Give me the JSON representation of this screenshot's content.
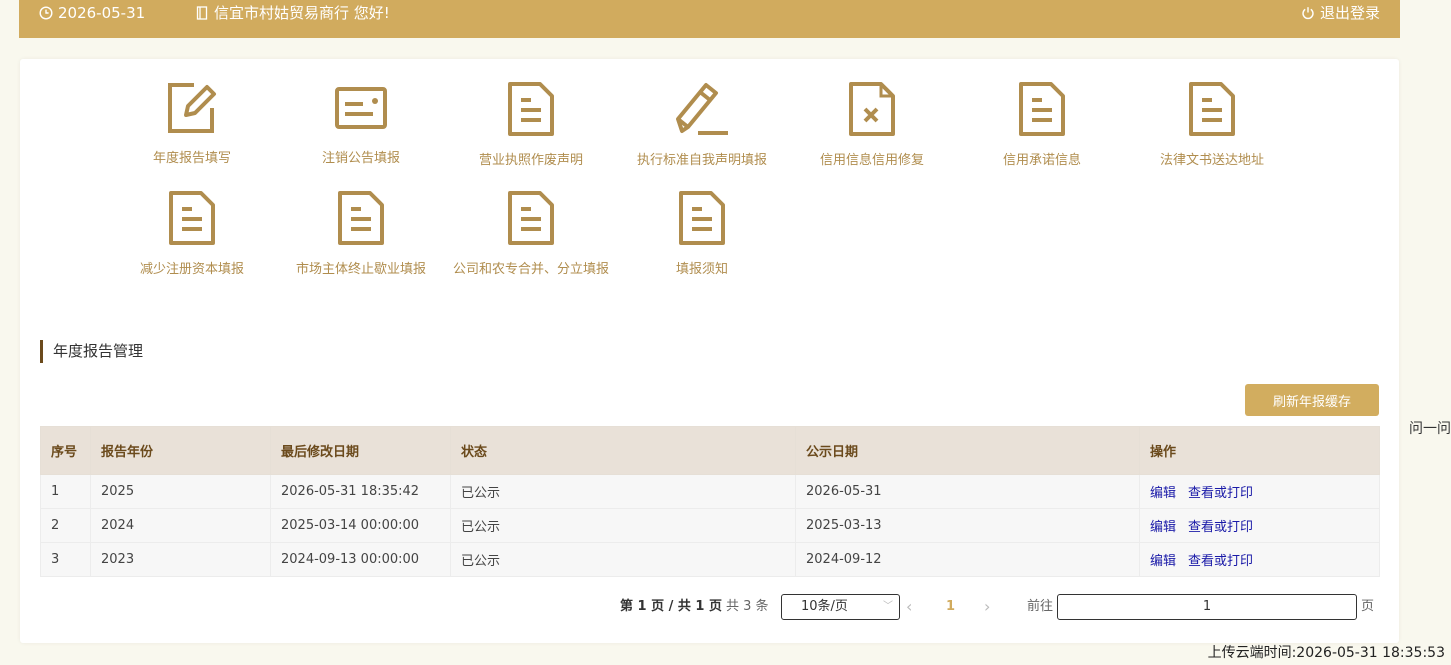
{
  "header": {
    "date": "2026-05-31",
    "greeting": "信宜市村姑贸易商行 您好!",
    "logout_label": "退出登录"
  },
  "side_note": "问一问",
  "footer": {
    "upload_time": "上传云端时间:2026-05-31 18:35:53"
  },
  "menu": [
    {
      "label": "年度报告填写",
      "icon": "edit-icon"
    },
    {
      "label": "注销公告填报",
      "icon": "card-icon"
    },
    {
      "label": "营业执照作废声明",
      "icon": "document-icon"
    },
    {
      "label": "执行标准自我声明填报",
      "icon": "pen-icon"
    },
    {
      "label": "信用信息信用修复",
      "icon": "document-x-icon"
    },
    {
      "label": "信用承诺信息",
      "icon": "document-icon"
    },
    {
      "label": "法律文书送达地址",
      "icon": "document-icon"
    },
    {
      "label": "减少注册资本填报",
      "icon": "document-icon"
    },
    {
      "label": "市场主体终止歇业填报",
      "icon": "document-icon"
    },
    {
      "label": "公司和农专合并、分立填报",
      "icon": "document-icon"
    },
    {
      "label": "填报须知",
      "icon": "document-icon"
    }
  ],
  "section": {
    "title": "年度报告管理",
    "refresh_label": "刷新年报缓存"
  },
  "table": {
    "headers": [
      "序号",
      "报告年份",
      "最后修改日期",
      "状态",
      "公示日期",
      "操作"
    ],
    "rows": [
      {
        "no": "1",
        "year": "2025",
        "modified": "2026-05-31 18:35:42",
        "status": "已公示",
        "publish": "2026-05-31",
        "edit": "编辑",
        "view": "查看或打印"
      },
      {
        "no": "2",
        "year": "2024",
        "modified": "2025-03-14 00:00:00",
        "status": "已公示",
        "publish": "2025-03-13",
        "edit": "编辑",
        "view": "查看或打印"
      },
      {
        "no": "3",
        "year": "2023",
        "modified": "2024-09-13 00:00:00",
        "status": "已公示",
        "publish": "2024-09-12",
        "edit": "编辑",
        "view": "查看或打印"
      }
    ]
  },
  "pager": {
    "summary": "第 1 页 / 共 1 页",
    "total": "共 3 条",
    "page_size": "10条/页",
    "prev": "‹",
    "current": "1",
    "next": "›",
    "goto_label": "前往",
    "goto_value": "1",
    "page_unit": "页"
  },
  "colors": {
    "header_bg": "#d1ab5e",
    "icon": "#b08d4e",
    "button_bg": "#d2ad5f",
    "table_header_bg": "#e9e1d8",
    "link": "#1a1aa8"
  }
}
